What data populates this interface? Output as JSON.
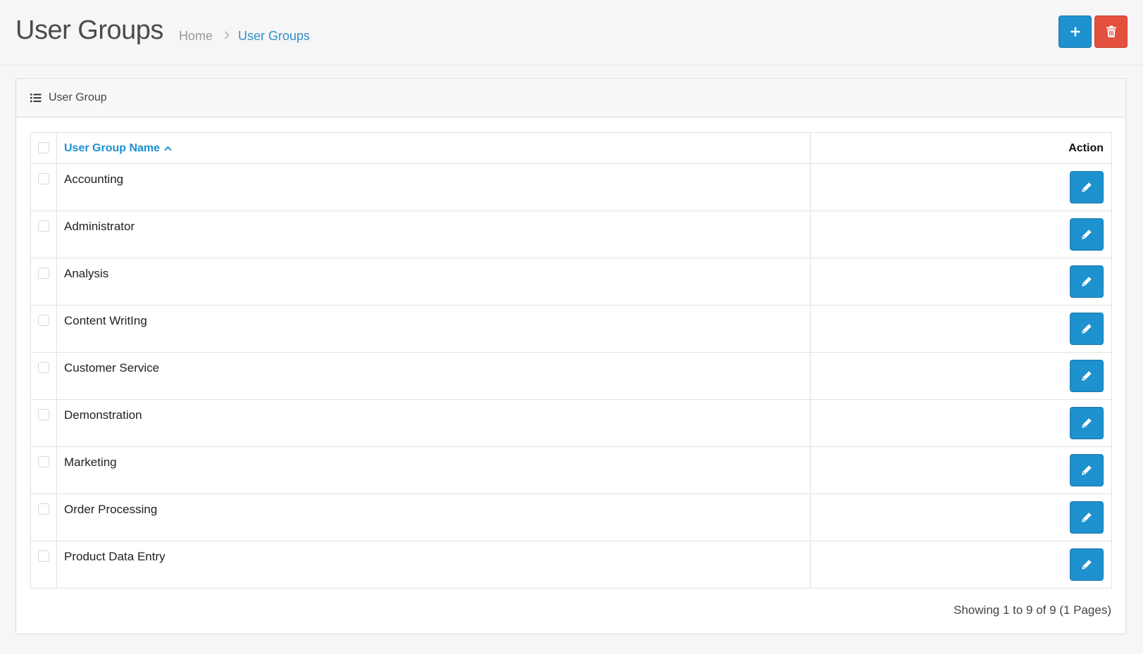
{
  "header": {
    "title": "User Groups",
    "breadcrumb": [
      {
        "label": "Home"
      },
      {
        "label": "User Groups"
      }
    ],
    "breadcrumb_separator": ">",
    "add_button_icon": "plus-icon",
    "delete_button_icon": "trash-icon"
  },
  "panel": {
    "icon": "list-icon",
    "title": "User Group"
  },
  "table": {
    "columns": {
      "name": "User Group Name",
      "name_sort": "ascending",
      "action": "Action"
    },
    "rows": [
      {
        "name": "Accounting"
      },
      {
        "name": "Administrator"
      },
      {
        "name": "Analysis"
      },
      {
        "name": "Content WritIng"
      },
      {
        "name": "Customer Service"
      },
      {
        "name": "Demonstration"
      },
      {
        "name": "Marketing"
      },
      {
        "name": "Order Processing"
      },
      {
        "name": "Product Data Entry"
      }
    ],
    "row_action_icon": "pencil-icon"
  },
  "pagination": {
    "summary": "Showing 1 to 9 of 9 (1 Pages)"
  },
  "colors": {
    "primary": "#1e91cf",
    "danger": "#e3503e",
    "link": "#3090c7"
  }
}
